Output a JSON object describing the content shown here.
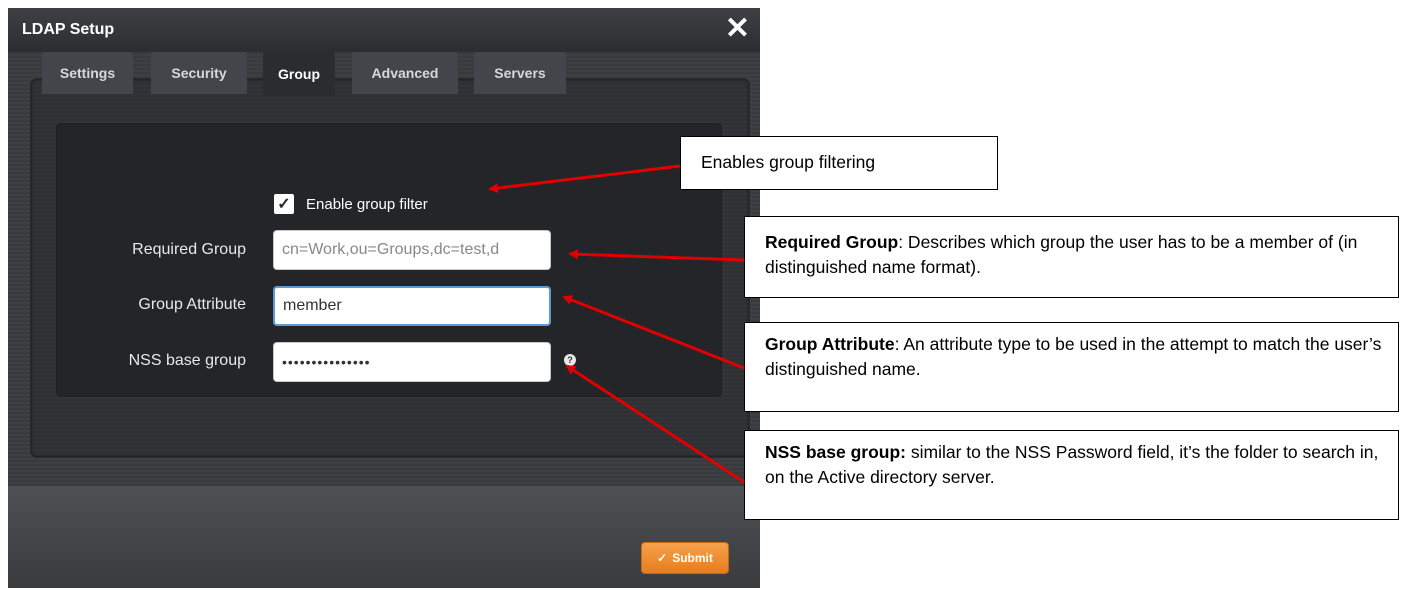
{
  "dialog": {
    "title": "LDAP Setup",
    "close_symbol": "✕",
    "tabs": [
      {
        "label": "Settings",
        "active": false
      },
      {
        "label": "Security",
        "active": false
      },
      {
        "label": "Group",
        "active": true
      },
      {
        "label": "Advanced",
        "active": false
      },
      {
        "label": "Servers",
        "active": false
      }
    ],
    "enable_group_filter": {
      "label": "Enable group filter",
      "checked": true,
      "check_symbol": "✓"
    },
    "fields": {
      "required_group": {
        "label": "Required Group",
        "value": "cn=Work,ou=Groups,dc=test,d"
      },
      "group_attribute": {
        "label": "Group Attribute",
        "value": "member"
      },
      "nss_base_group": {
        "label": "NSS base group",
        "value": "•••••••••••••••"
      }
    },
    "help_symbol": "?",
    "submit": {
      "icon": "✓",
      "label": "Submit"
    }
  },
  "callouts": {
    "enable": {
      "text": "Enables group filtering"
    },
    "required_group": {
      "term": "Required Group",
      "text": ": Describes which group the user has to be a member of (in distinguished name format)."
    },
    "group_attribute": {
      "term": "Group Attribute",
      "text": ": An attribute type to be used in the attempt to match the user’s distinguished name."
    },
    "nss_base_group": {
      "term": "NSS base group:",
      "text": " similar to the NSS Password field, it’s the folder to search in, on the Active directory server."
    }
  },
  "colors": {
    "accent": "#f28c28",
    "arrow": "#e00000",
    "focus": "#5b9bd5"
  }
}
